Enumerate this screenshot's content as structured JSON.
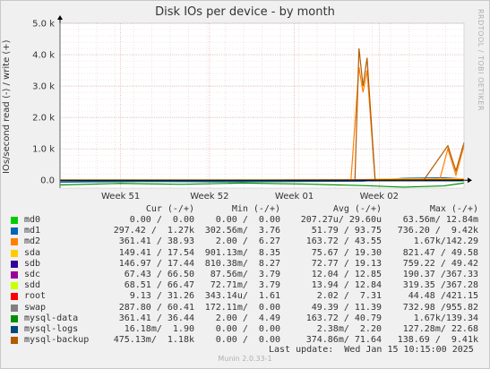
{
  "title": "Disk IOs per device - by month",
  "side_label": "RRDTOOL / TOBI OETIKER",
  "ylabel": "IOs/second read (-) / write (+)",
  "chart_data": {
    "type": "line",
    "title": "Disk IOs per device - by month",
    "ylabel": "IOs/second read (-) / write (+)",
    "ylim": [
      -250,
      5000
    ],
    "y_ticks": [
      {
        "value": 0,
        "label": "0.0"
      },
      {
        "value": 1000,
        "label": "1.0 k"
      },
      {
        "value": 2000,
        "label": "2.0 k"
      },
      {
        "value": 3000,
        "label": "3.0 k"
      },
      {
        "value": 4000,
        "label": "4.0 k"
      },
      {
        "value": 5000,
        "label": "5.0 k"
      }
    ],
    "x_ticks": [
      "Week 51",
      "Week 52",
      "Week 01",
      "Week 02"
    ],
    "grid": true,
    "series": [
      {
        "name": "md0",
        "color": "#00cc00",
        "x": [
          0.0,
          0.25,
          0.5,
          0.75,
          1.0
        ],
        "y": [
          0,
          0,
          0,
          0,
          10
        ]
      },
      {
        "name": "md1",
        "color": "#0066b3",
        "x": [
          0.0,
          0.2,
          0.4,
          0.6,
          0.75,
          0.85,
          0.95,
          1.0
        ],
        "y": [
          -60,
          -40,
          -50,
          -40,
          -30,
          60,
          80,
          40
        ]
      },
      {
        "name": "md2",
        "color": "#ff8000",
        "x": [
          0.0,
          0.3,
          0.6,
          0.72,
          0.74,
          0.75,
          0.76,
          0.78,
          0.85,
          0.9,
          0.94,
          0.96,
          0.98,
          1.0
        ],
        "y": [
          -20,
          -20,
          -20,
          -20,
          3600,
          2800,
          3500,
          -20,
          20,
          20,
          30,
          1000,
          160,
          1100
        ]
      },
      {
        "name": "sda",
        "color": "#ffcc00",
        "x": [
          0.0,
          0.5,
          0.75,
          0.8,
          1.0
        ],
        "y": [
          10,
          10,
          20,
          40,
          50
        ]
      },
      {
        "name": "sdb",
        "color": "#330099",
        "x": [
          0.0,
          0.25,
          0.5,
          0.75,
          1.0
        ],
        "y": [
          -10,
          -10,
          -10,
          -10,
          -10
        ]
      },
      {
        "name": "sdc",
        "color": "#990099",
        "x": [
          0.0,
          0.5,
          1.0
        ],
        "y": [
          5,
          5,
          10
        ]
      },
      {
        "name": "sdd",
        "color": "#ccff00",
        "x": [
          0.0,
          0.5,
          1.0
        ],
        "y": [
          -5,
          -5,
          -5
        ]
      },
      {
        "name": "root",
        "color": "#ff0000",
        "x": [
          0.0,
          0.5,
          1.0
        ],
        "y": [
          5,
          5,
          10
        ]
      },
      {
        "name": "swap",
        "color": "#808080",
        "x": [
          0.0,
          0.25,
          0.5,
          0.75,
          1.0
        ],
        "y": [
          -5,
          -5,
          -5,
          -5,
          -5
        ]
      },
      {
        "name": "mysql-data",
        "color": "#008f00",
        "x": [
          0.0,
          0.15,
          0.3,
          0.45,
          0.6,
          0.75,
          0.85,
          0.95,
          1.0
        ],
        "y": [
          -150,
          -100,
          -130,
          -90,
          -120,
          -170,
          -220,
          -180,
          -90
        ]
      },
      {
        "name": "mysql-logs",
        "color": "#00487d",
        "x": [
          0.0,
          0.5,
          1.0
        ],
        "y": [
          -20,
          -20,
          -20
        ]
      },
      {
        "name": "mysql-backup",
        "color": "#b35a00",
        "x": [
          0.0,
          0.3,
          0.6,
          0.73,
          0.74,
          0.75,
          0.76,
          0.78,
          0.9,
          0.96,
          0.98,
          1.0
        ],
        "y": [
          0,
          0,
          0,
          0,
          4200,
          3000,
          3900,
          0,
          0,
          1100,
          300,
          1200
        ]
      }
    ]
  },
  "legend": {
    "headers": {
      "cur": "Cur (-/+)",
      "min": "Min (-/+)",
      "avg": "Avg (-/+)",
      "max": "Max (-/+)"
    },
    "rows": [
      {
        "name": "md0",
        "cur": "0.00 /  0.00",
        "min": "0.00 /  0.00",
        "avg": "207.27u/ 29.60u",
        "max": "63.56m/ 12.84m",
        "color": "#00cc00"
      },
      {
        "name": "md1",
        "cur": "297.42 /  1.27k",
        "min": "302.56m/  3.76",
        "avg": "51.79 / 93.75",
        "max": "736.20 /  9.42k",
        "color": "#0066b3"
      },
      {
        "name": "md2",
        "cur": "361.41 / 38.93",
        "min": "2.00 /  6.27",
        "avg": "163.72 / 43.55",
        "max": "1.67k/142.29",
        "color": "#ff8000"
      },
      {
        "name": "sda",
        "cur": "149.41 / 17.54",
        "min": "901.13m/  8.35",
        "avg": "75.67 / 19.30",
        "max": "821.47 / 49.58",
        "color": "#ffcc00"
      },
      {
        "name": "sdb",
        "cur": "146.97 / 17.44",
        "min": "810.38m/  8.27",
        "avg": "72.77 / 19.13",
        "max": "759.22 / 49.42",
        "color": "#330099"
      },
      {
        "name": "sdc",
        "cur": "67.43 / 66.50",
        "min": "87.56m/  3.79",
        "avg": "12.04 / 12.85",
        "max": "190.37 /367.33",
        "color": "#990099"
      },
      {
        "name": "sdd",
        "cur": "68.51 / 66.47",
        "min": "72.71m/  3.79",
        "avg": "13.94 / 12.84",
        "max": "319.35 /367.28",
        "color": "#ccff00"
      },
      {
        "name": "root",
        "cur": "9.13 / 31.26",
        "min": "343.14u/  1.61",
        "avg": "2.02 /  7.31",
        "max": "44.48 /421.15",
        "color": "#ff0000"
      },
      {
        "name": "swap",
        "cur": "287.80 / 60.41",
        "min": "172.11m/  0.00",
        "avg": "49.39 / 11.39",
        "max": "732.98 /955.82",
        "color": "#808080"
      },
      {
        "name": "mysql-data",
        "cur": "361.41 / 36.44",
        "min": "2.00 /  4.49",
        "avg": "163.72 / 40.79",
        "max": "1.67k/139.34",
        "color": "#008f00"
      },
      {
        "name": "mysql-logs",
        "cur": "16.18m/  1.90",
        "min": "0.00 /  0.00",
        "avg": "2.38m/  2.20",
        "max": "127.28m/ 22.68",
        "color": "#00487d"
      },
      {
        "name": "mysql-backup",
        "cur": "475.13m/  1.18k",
        "min": "0.00 /  0.00",
        "avg": "374.86m/ 71.64",
        "max": "138.69 /  9.41k",
        "color": "#b35a00"
      }
    ]
  },
  "last_update": "Last update:  Wed Jan 15 10:15:00 2025",
  "footer": "Munin 2.0.33-1"
}
